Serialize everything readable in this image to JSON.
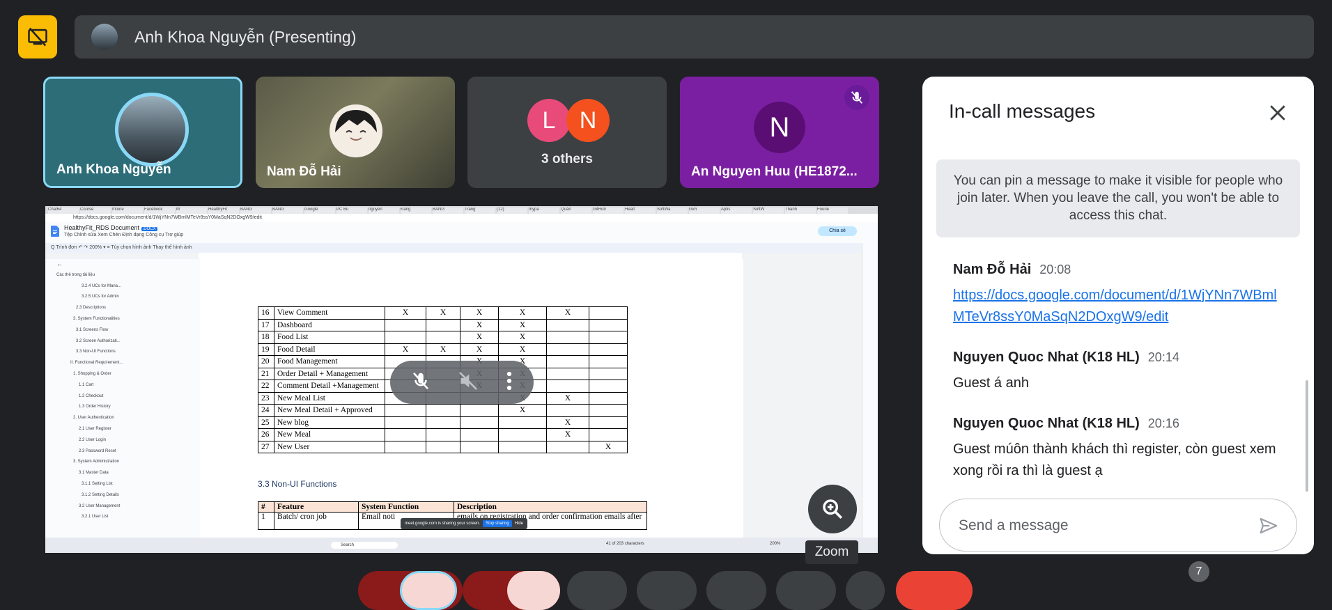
{
  "presenting": {
    "title": "Anh Khoa Nguyễn (Presenting)"
  },
  "tiles": [
    {
      "name": "Anh Khoa Nguyễn"
    },
    {
      "name": "Nam Đỗ Hải"
    },
    {
      "initials": [
        "L",
        "N"
      ],
      "label": "3 others"
    },
    {
      "initial": "N",
      "name": "An Nguyen Huu (HE1872..."
    }
  ],
  "shared_doc": {
    "tab_labels": [
      "Chat64",
      "Course",
      "Intune",
      "Facebook",
      "M",
      "HealthyFit",
      "BẢNG",
      "BẢNG",
      "Google",
      "PC Bu",
      "nguyen",
      "Đăng",
      "BẢNG",
      "Trang",
      "(12)",
      "mypa",
      "Quản",
      "GitHub",
      "Healt",
      "SoftWa",
      "Giới",
      "Aptis",
      "SoftW",
      "Thanh",
      "Fourie"
    ],
    "url": "https://docs.google.com/document/d/1WjYNn7WBmlMTeVr8ssY0MaSqN2DOxgW9/edit",
    "title": "HealthyFit_RDS Document",
    "title_badge": ".DOCX",
    "menu": "Tệp   Chỉnh sửa   Xem   Chèn   Định dạng   Công cụ   Trợ giúp",
    "share_label": "Chia sẻ",
    "toolbar": "Q  Trình đơn   ↶  ↷   200%  ▾   ≡   Tùy chọn hình ảnh    Thay thế hình ảnh",
    "outline": [
      "Các thẻ trong tài liệu",
      "3.2.4 UCs for Mana...",
      "3.2.5 UCs for Admin",
      "2.3 Descriptions",
      "3. System Functionalities",
      "3.1 Screens Flow",
      "3.2 Screen Authorizati...",
      "3.3 Non-UI Functions",
      "II. Functional Requirement...",
      "1. Shopping & Order",
      "1.1 Cart",
      "1.2 Checkout",
      "1.3 Order History",
      "2. User Authentication",
      "2.1 User Register",
      "2.2 User Login",
      "2.3 Password Reset",
      "3. System Administration",
      "3.1 Master Data",
      "3.1.1 Setting List",
      "3.1.2 Setting Details",
      "3.2 User Management",
      "3.2.1 User List"
    ],
    "requirements": [
      {
        "no": "16",
        "name": "View Comment",
        "marks": [
          "X",
          "X",
          "X",
          "X",
          "X",
          ""
        ]
      },
      {
        "no": "17",
        "name": "Dashboard",
        "marks": [
          "",
          "",
          "X",
          "X",
          "",
          ""
        ]
      },
      {
        "no": "18",
        "name": "Food List",
        "marks": [
          "",
          "",
          "X",
          "X",
          "",
          ""
        ]
      },
      {
        "no": "19",
        "name": "Food Detail",
        "marks": [
          "X",
          "X",
          "X",
          "X",
          "",
          ""
        ]
      },
      {
        "no": "20",
        "name": "Food  Management",
        "marks": [
          "",
          "",
          "X",
          "X",
          "",
          ""
        ]
      },
      {
        "no": "21",
        "name": "Order Detail + Management",
        "marks": [
          "",
          "",
          "X",
          "X",
          "",
          ""
        ]
      },
      {
        "no": "22",
        "name": "Comment Detail +Management",
        "marks": [
          "",
          "",
          "X",
          "X",
          "",
          ""
        ]
      },
      {
        "no": "23",
        "name": "New Meal List",
        "marks": [
          "",
          "",
          "",
          "X",
          "X",
          ""
        ]
      },
      {
        "no": "24",
        "name": "New Meal Detail + Approved",
        "marks": [
          "",
          "",
          "",
          "X",
          "",
          ""
        ]
      },
      {
        "no": "25",
        "name": "New blog",
        "marks": [
          "",
          "",
          "",
          "",
          "X",
          ""
        ]
      },
      {
        "no": "26",
        "name": "New Meal",
        "marks": [
          "",
          "",
          "",
          "",
          "X",
          ""
        ]
      },
      {
        "no": "27",
        "name": "New User",
        "marks": [
          "",
          "",
          "",
          "",
          "",
          "X"
        ]
      }
    ],
    "nonui_title": "3.3 Non-UI Functions",
    "nonui_headers": [
      "#",
      "Feature",
      "System Function",
      "Description"
    ],
    "nonui_rows": [
      {
        "no": "1",
        "feature": "Batch/ cron job",
        "func": "Email noti",
        "desc": "emails on registration and order confirmation emails after checkout."
      }
    ],
    "share_notice": "meet.google.com is sharing your screen.",
    "share_notice_stop": "Stop sharing",
    "share_notice_hide": "Hide",
    "taskbar_search": "Search",
    "status_words": "41 of 203 characters",
    "zoom_text": "200%"
  },
  "zoom": {
    "tooltip": "Zoom"
  },
  "chat": {
    "title": "In-call messages",
    "pin_note": "You can pin a message to make it visible for people who join later. When you leave the call, you won't be able to access this chat.",
    "messages": [
      {
        "author": "Nam Đỗ Hải",
        "time": "20:08",
        "link": "https://docs.google.com/document/d/1WjYNn7WBmlMTeVr8ssY0MaSqN2DOxgW9/edit"
      },
      {
        "author": "Nguyen Quoc Nhat (K18 HL)",
        "time": "20:14",
        "text": "Guest á anh"
      },
      {
        "author": "Nguyen Quoc Nhat (K18 HL)",
        "time": "20:16",
        "text": "Guest múôn thành khách thì register, còn guest xem xong rồi ra thì là guest ạ"
      }
    ],
    "input_placeholder": "Send a message"
  },
  "people_badge": "7",
  "colors": {
    "accent_yellow": "#fbbc04",
    "tile_purple": "#7b1fa2",
    "speaking_border": "#8ad8f6",
    "leave_red": "#ea4335"
  },
  "icons": [
    "present-stop-icon",
    "mic-off-icon",
    "camera-off-icon",
    "more-vert-icon",
    "zoom-in-icon",
    "close-icon",
    "send-icon"
  ]
}
